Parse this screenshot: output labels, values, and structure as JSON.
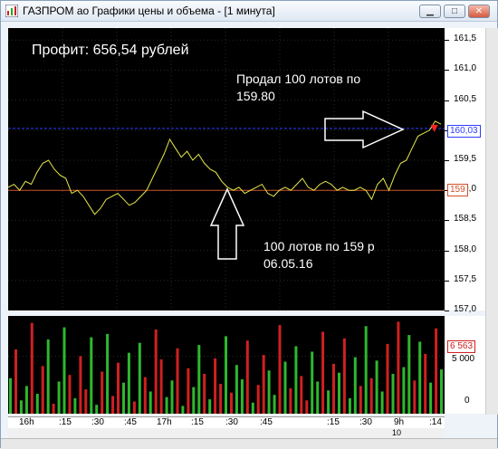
{
  "window": {
    "title": "ГАЗПРОМ ао Графики цены и объема - [1 минута]"
  },
  "annotations": {
    "profit": "Профит: 656,54 рублей",
    "sell_line1": "Продал 100 лотов по",
    "sell_line2": "159.80",
    "buy_line1": "100  лотов по 159 р",
    "buy_line2": "06.05.16"
  },
  "price_axis": {
    "ticks": [
      "161,5",
      "161,0",
      "160,5",
      "160,0",
      "159,5",
      "159,0",
      "158,5",
      "158,0",
      "157,5",
      "157,0"
    ],
    "tag_high": "160,03",
    "tag_low": "159"
  },
  "volume_axis": {
    "ticks": [
      "5 000",
      "0"
    ],
    "tag": "6 563"
  },
  "time_axis": {
    "labels": [
      "16h",
      ":15",
      ":30",
      ":45",
      "17h",
      ":15",
      ":30",
      ":45",
      ":15",
      ":30",
      "9h",
      ":14"
    ],
    "day_label": "10"
  },
  "colors": {
    "bid_line": "#2d3cff",
    "ask_line": "#d0502a",
    "price": "#e8e84a",
    "vol_up": "#2eb82e",
    "vol_down": "#d02020",
    "marker": "#ff2020"
  },
  "chart_data": [
    {
      "type": "line",
      "name": "price",
      "ylim": [
        157.0,
        161.7
      ],
      "levels": [
        160.03,
        159.0
      ],
      "values": [
        159.05,
        159.1,
        159.0,
        159.15,
        159.1,
        159.3,
        159.45,
        159.5,
        159.35,
        159.25,
        159.2,
        158.95,
        159.0,
        158.9,
        158.75,
        158.6,
        158.7,
        158.85,
        158.9,
        158.95,
        158.85,
        158.75,
        158.8,
        158.9,
        159.0,
        159.2,
        159.4,
        159.6,
        159.85,
        159.7,
        159.55,
        159.65,
        159.5,
        159.6,
        159.45,
        159.35,
        159.3,
        159.15,
        159.05,
        159.0,
        159.05,
        158.95,
        159.0,
        159.05,
        159.1,
        158.95,
        158.9,
        159.0,
        159.05,
        159.0,
        159.1,
        159.2,
        159.05,
        159.0,
        159.1,
        159.15,
        159.1,
        159.0,
        159.05,
        159.0,
        159.0,
        159.05,
        159.0,
        158.85,
        159.1,
        159.2,
        159.0,
        159.25,
        159.45,
        159.5,
        159.7,
        159.9,
        159.95,
        160.0,
        160.15,
        160.1
      ]
    },
    {
      "type": "bar",
      "name": "volume",
      "ylim": [
        0,
        8500
      ],
      "values": [
        3200,
        5800,
        1200,
        2500,
        8200,
        1800,
        4300,
        6700,
        900,
        2900,
        7800,
        3500,
        1400,
        5200,
        2200,
        6900,
        800,
        3800,
        7200,
        1600,
        4600,
        2800,
        5500,
        1100,
        6400,
        3300,
        2000,
        7600,
        4900,
        1500,
        3000,
        5900,
        700,
        4100,
        2400,
        6200,
        3600,
        1300,
        5000,
        2700,
        7000,
        1900,
        4400,
        3100,
        6600,
        1000,
        2600,
        5300,
        3900,
        1700,
        8000,
        4700,
        2300,
        6100,
        3400,
        1200,
        5600,
        2900,
        7400,
        2100,
        4500,
        3700,
        6800,
        1400,
        5100,
        2500,
        7900,
        3200,
        4800,
        2000,
        6300,
        3600,
        8300,
        4200,
        7100,
        3000,
        6500,
        5400,
        2800,
        7700,
        4000
      ],
      "directions": [
        1,
        0,
        1,
        1,
        0,
        1,
        0,
        1,
        0,
        1,
        1,
        0,
        1,
        0,
        0,
        1,
        1,
        0,
        1,
        0,
        0,
        1,
        1,
        0,
        1,
        0,
        1,
        0,
        0,
        1,
        1,
        0,
        1,
        0,
        1,
        1,
        0,
        1,
        0,
        0,
        1,
        0,
        1,
        1,
        0,
        1,
        0,
        0,
        1,
        1,
        0,
        1,
        0,
        1,
        0,
        0,
        1,
        1,
        0,
        1,
        0,
        1,
        0,
        1,
        1,
        0,
        1,
        0,
        1,
        1,
        0,
        1,
        0,
        1,
        1,
        0,
        1,
        0,
        1,
        0,
        1
      ]
    }
  ]
}
